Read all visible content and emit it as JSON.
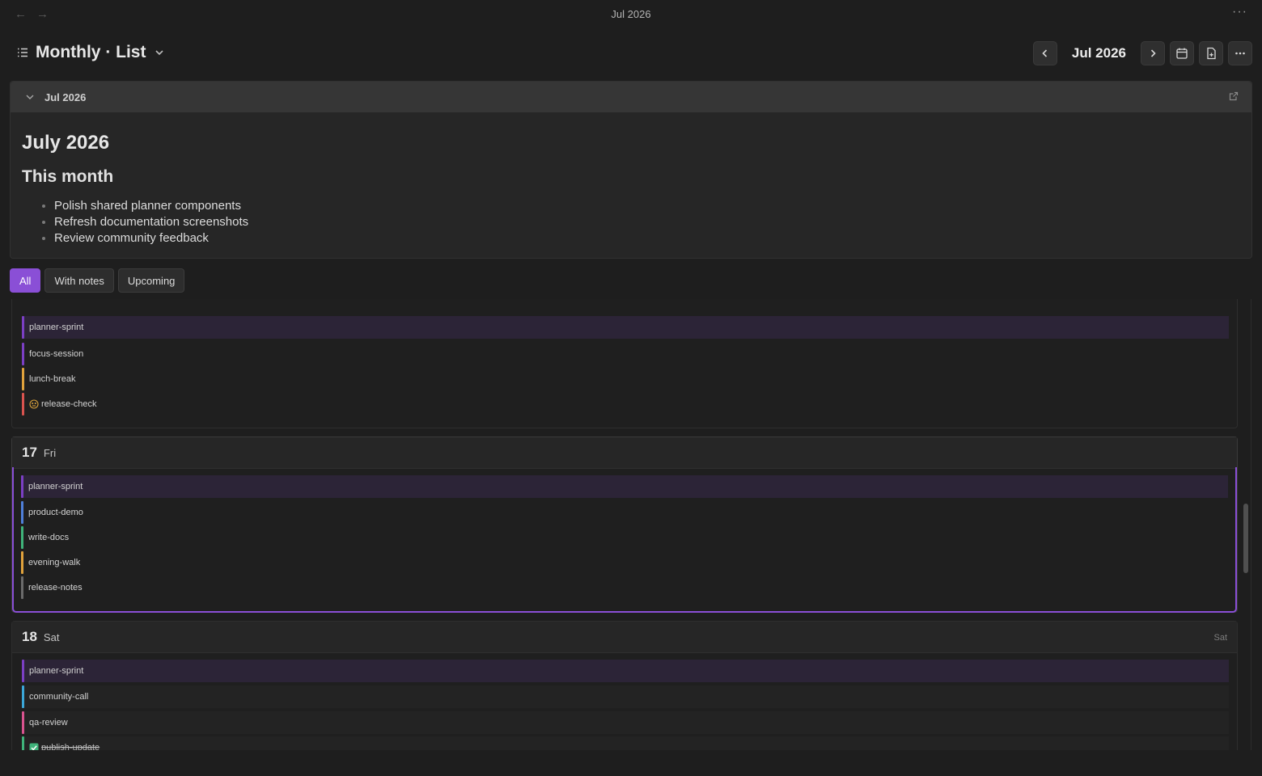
{
  "window": {
    "title": "Jul 2026",
    "back_glyph": "←",
    "forward_glyph": "→",
    "more_glyph": "···"
  },
  "header": {
    "view_title": "Monthly · List",
    "month_label": "Jul 2026",
    "icons": [
      "list-icon",
      "chevron-down-icon",
      "chevron-left-icon",
      "chevron-right-icon",
      "calendar-icon",
      "new-note-icon",
      "more-icon"
    ]
  },
  "note": {
    "header_label": "Jul 2026",
    "heading": "July 2026",
    "subheading": "This month",
    "items": [
      "Polish shared planner components",
      "Refresh documentation screenshots",
      "Review community feedback"
    ]
  },
  "filters": {
    "all": "All",
    "with_notes": "With notes",
    "upcoming": "Upcoming"
  },
  "days": [
    {
      "events": [
        {
          "label": "planner-sprint",
          "color": "#7b3fc4"
        },
        {
          "label": "focus-session",
          "color": "#7b3fc4"
        },
        {
          "label": "lunch-break",
          "color": "#e0a23c"
        },
        {
          "label": "release-check",
          "color": "#d9534f",
          "icon": "pending-icon"
        }
      ]
    },
    {
      "number": "17",
      "name": "Fri",
      "selected": true,
      "events": [
        {
          "label": "planner-sprint",
          "color": "#7b3fc4"
        },
        {
          "label": "product-demo",
          "color": "#4f7fd9"
        },
        {
          "label": "write-docs",
          "color": "#3fb37a"
        },
        {
          "label": "evening-walk",
          "color": "#e0a23c"
        },
        {
          "label": "release-notes",
          "color": "#6b6b6b"
        }
      ]
    },
    {
      "number": "18",
      "name": "Sat",
      "right_label": "Sat",
      "events": [
        {
          "label": "planner-sprint",
          "color": "#7b3fc4"
        },
        {
          "label": "community-call",
          "color": "#3ba7d9"
        },
        {
          "label": "qa-review",
          "color": "#d9538f"
        },
        {
          "label": "publish-update",
          "color": "#3fb37a",
          "done": true
        }
      ]
    }
  ],
  "colors": {
    "accent": "#8a4fd6",
    "background": "#1e1e1e"
  }
}
